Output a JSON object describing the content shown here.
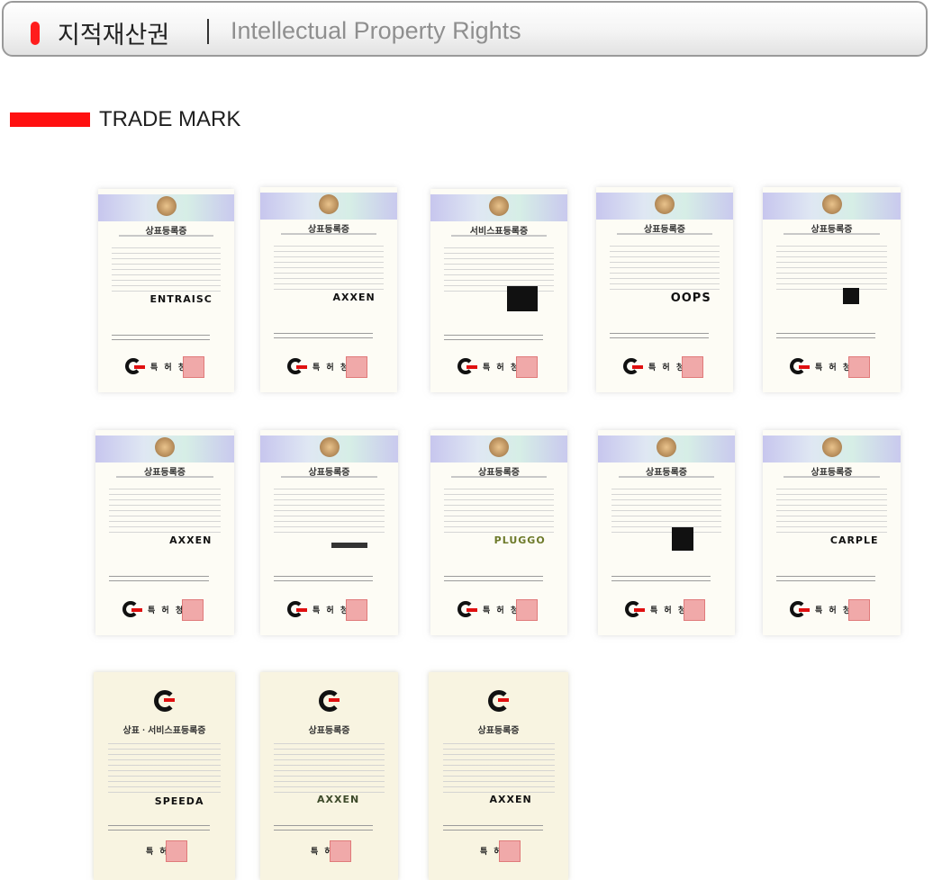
{
  "header": {
    "title_ko": "지적재산권",
    "title_en": "Intellectual Property Rights",
    "accent_color": "#ff1d1d"
  },
  "section": {
    "title": "TRADE MARK",
    "bar_color": "#ff1010"
  },
  "certificates": [
    {
      "title": "상표등록증",
      "mark": "ENTRAISC",
      "issuer": "특 허 청"
    },
    {
      "title": "상표등록증",
      "mark": "AXXEN",
      "issuer": "특 허 청"
    },
    {
      "title": "서비스표등록증",
      "mark": "",
      "issuer": "특 허 청"
    },
    {
      "title": "상표등록증",
      "mark": "OOPS",
      "issuer": "특 허 청"
    },
    {
      "title": "상표등록증",
      "mark": "",
      "issuer": "특 허 청"
    },
    {
      "title": "상표등록증",
      "mark": "AXXEN",
      "issuer": "특 허 청"
    },
    {
      "title": "상표등록증",
      "mark": "",
      "issuer": "특 허 청"
    },
    {
      "title": "상표등록증",
      "mark": "PLUGGO",
      "issuer": "특 허 청"
    },
    {
      "title": "상표등록증",
      "mark": "",
      "issuer": "특 허 청"
    },
    {
      "title": "상표등록증",
      "mark": "CARPLE",
      "issuer": "특 허 청"
    },
    {
      "title": "상표ㆍ서비스표등록증",
      "mark": "SPEEDA",
      "issuer": "특 허 청"
    },
    {
      "title": "상표등록증",
      "mark": "AXXEN",
      "issuer": "특 허 청"
    },
    {
      "title": "상표등록증",
      "mark": "AXXEN",
      "issuer": "특 허 청"
    }
  ]
}
